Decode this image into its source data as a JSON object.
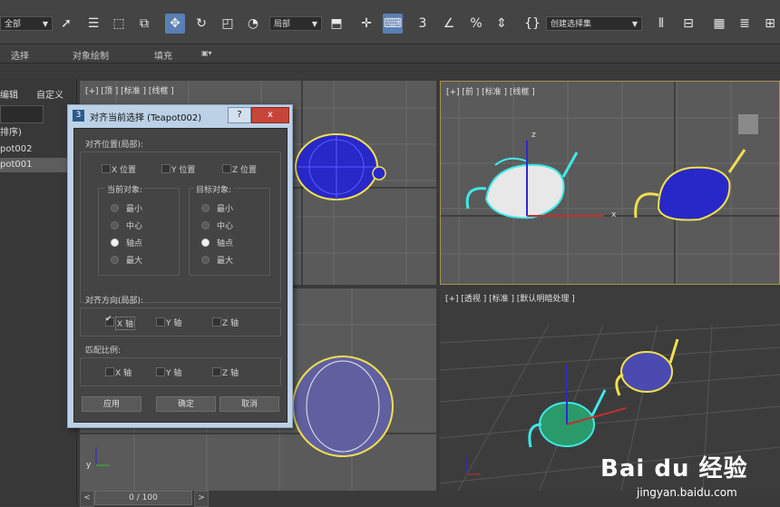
{
  "toolbar": {
    "filter_dropdown": "全部",
    "coord_dropdown": "局部",
    "selection_set_dropdown": "创建选择集",
    "snap_label": "3",
    "percent_label": "%"
  },
  "ribbon": {
    "tabs": [
      "选择",
      "对象绘制",
      "填充"
    ]
  },
  "explorer": {
    "header_edit": "编辑",
    "header_custom": "自定义",
    "sort_label": "排序)",
    "items": [
      "pot002",
      "pot001"
    ]
  },
  "viewports": {
    "top": "[+] [顶 ] [标准 ] [线框 ]",
    "front": "[+] [前 ] [标准 ] [线框 ]",
    "persp": "[+] [透视 ] [标准 ] [默认明暗处理 ]",
    "axis_x": "x",
    "axis_y": "y",
    "axis_z": "z"
  },
  "dialog": {
    "title": "对齐当前选择 (Teapot002)",
    "help": "?",
    "close": "x",
    "align_position_label": "对齐位置(局部):",
    "x_pos": "X 位置",
    "y_pos": "Y 位置",
    "z_pos": "Z 位置",
    "current_obj_label": "当前对象:",
    "target_obj_label": "目标对象:",
    "options": [
      "最小",
      "中心",
      "轴点",
      "最大"
    ],
    "align_orient_label": "对齐方向(局部):",
    "x_axis": "X 轴",
    "y_axis": "Y 轴",
    "z_axis": "Z 轴",
    "match_scale_label": "匹配比例:",
    "apply": "应用",
    "ok": "确定",
    "cancel": "取消"
  },
  "timeline": {
    "frame": "0 / 100",
    "prev": "<",
    "next": ">"
  },
  "watermark": {
    "brand": "Bai du 经验",
    "url": "jingyan.baidu.com"
  },
  "colors": {
    "accent": "#5a7fb5",
    "selection_yellow": "#f0e050",
    "wire_blue": "#2828c8",
    "selection_cyan": "#40e8e8"
  }
}
